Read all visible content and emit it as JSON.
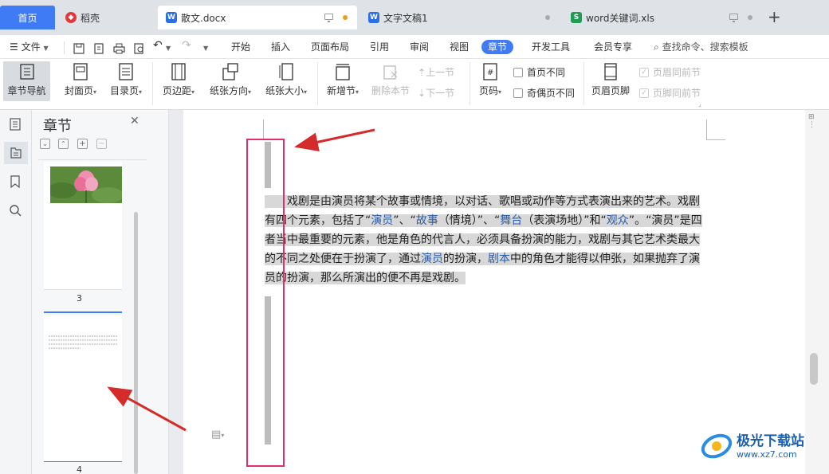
{
  "tabs": [
    {
      "label": "首页",
      "kind": "home"
    },
    {
      "label": "稻壳",
      "icon": "daoke-icon",
      "color": "#e0383e"
    },
    {
      "label": "散文.docx",
      "icon": "word-doc-icon",
      "color": "#2b6fe0",
      "active": true,
      "unsaved": true
    },
    {
      "label": "文字文稿1",
      "icon": "word-doc-icon",
      "color": "#2b6fe0"
    },
    {
      "label": "word关键词.xls",
      "icon": "excel-doc-icon",
      "color": "#1f9d55"
    }
  ],
  "menubar": {
    "file_label": "文件",
    "items": [
      "开始",
      "插入",
      "页面布局",
      "引用",
      "审阅",
      "视图",
      "章节",
      "开发工具",
      "会员专享"
    ],
    "selected": "章节",
    "search_placeholder": "查找命令、搜索模板"
  },
  "ribbon": {
    "nav": "章节导航",
    "cover": "封面页",
    "toc": "目录页",
    "margin": "页边距",
    "orientation": "纸张方向",
    "size": "纸张大小",
    "new_section": "新增节",
    "delete_section": "删除本节",
    "prev_section": "上一节",
    "next_section": "下一节",
    "page_number": "页码",
    "first_page_diff": "首页不同",
    "odd_even_diff": "奇偶页不同",
    "header_footer": "页眉页脚",
    "header_prev": "页眉同前节",
    "footer_prev": "页脚同前节"
  },
  "nav_panel": {
    "title": "章节",
    "pages": [
      "3",
      "4"
    ]
  },
  "document": {
    "paragraph": [
      {
        "t": "　　戏剧是由演员将某个故事或情境，以对话、歌唱或动作等方式表演出来的艺术。戏剧有四个元素，包括了“"
      },
      {
        "t": "演员",
        "link": true
      },
      {
        "t": "”、“"
      },
      {
        "t": "故事",
        "link": true
      },
      {
        "t": "（情境）”、“"
      },
      {
        "t": "舞台",
        "link": true
      },
      {
        "t": "（表演场地）”和“"
      },
      {
        "t": "观众",
        "link": true
      },
      {
        "t": "”。“演员”是四者当中最重要的元素，他是角色的代言人，必须具备扮演的能力，戏剧与其它艺术类最大的不同之处便在于扮演了，通过"
      },
      {
        "t": "演员",
        "link": true
      },
      {
        "t": "的扮演，"
      },
      {
        "t": "剧本",
        "link": true
      },
      {
        "t": "中的角色才能得以伸张，如果抛弃了演员的扮演，那么所演出的便不再是戏剧。"
      }
    ]
  },
  "watermark": {
    "brand": "极光下载站",
    "url": "www.xz7.com"
  },
  "colors": {
    "accent": "#3e7bf5",
    "highlight_box": "#e0306a",
    "arrow": "#d42b2b"
  }
}
